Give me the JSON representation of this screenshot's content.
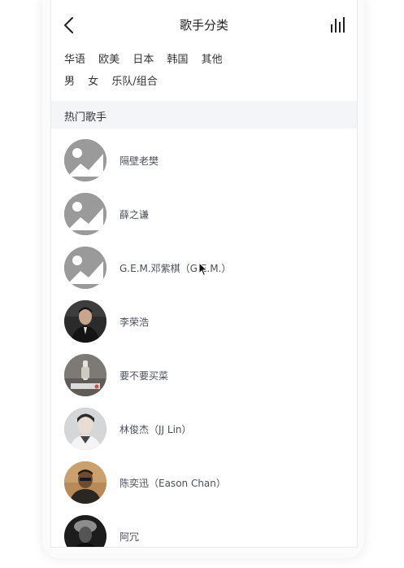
{
  "header": {
    "title": "歌手分类",
    "back_icon": "chevron-left-icon",
    "chart_icon": "bars-icon"
  },
  "filters": {
    "area": [
      "华语",
      "欧美",
      "日本",
      "韩国",
      "其他"
    ],
    "type": [
      "男",
      "女",
      "乐队/组合"
    ]
  },
  "section": {
    "title": "热门歌手"
  },
  "singers": [
    {
      "name": "隔壁老樊",
      "avatar": "placeholder"
    },
    {
      "name": "薛之谦",
      "avatar": "placeholder"
    },
    {
      "name": "G.E.M.邓紫棋（G.E.M.）",
      "avatar": "placeholder"
    },
    {
      "name": "李荣浩",
      "avatar": "photo"
    },
    {
      "name": "要不要买菜",
      "avatar": "photo"
    },
    {
      "name": "林俊杰（JJ Lin）",
      "avatar": "photo"
    },
    {
      "name": "陈奕迅（Eason Chan）",
      "avatar": "photo"
    },
    {
      "name": "阿冗",
      "avatar": "photo"
    }
  ],
  "colors": {
    "background": "#ffffff",
    "section_bg": "#f4f5f7",
    "placeholder": "#999999",
    "text": "#333333",
    "name_text": "#4a4f57"
  }
}
